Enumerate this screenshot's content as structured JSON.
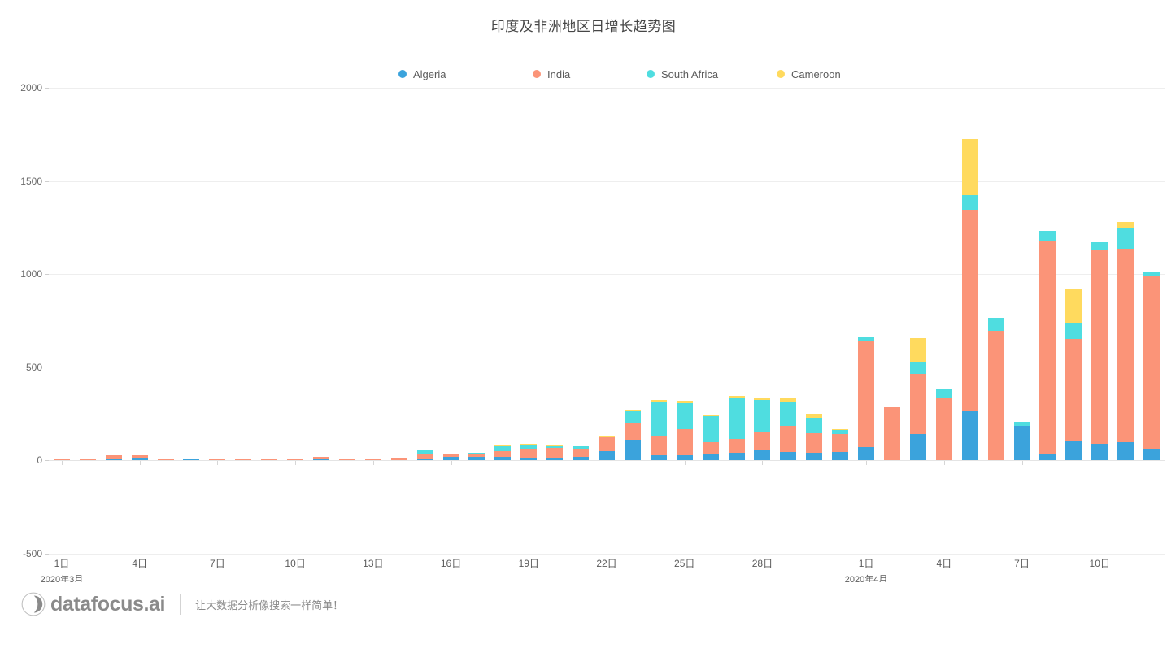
{
  "title": "印度及非洲地区日增长趋势图",
  "footer": {
    "logo_text": "datafocus.ai",
    "logo_icon": "datafocus-moon-icon",
    "tagline": "让大数据分析像搜索一样简单！"
  },
  "chart_data": {
    "type": "bar",
    "stacked": true,
    "title": "印度及非洲地区日增长趋势图",
    "xlabel": "",
    "ylabel": "",
    "ylim": [
      -500,
      2000
    ],
    "yticks": [
      2000,
      1500,
      1000,
      500,
      0,
      -500
    ],
    "ytick_labels": [
      "2000",
      "1500",
      "1000",
      "500",
      "0",
      "-500"
    ],
    "grid": true,
    "legend_position": "top-center",
    "colors": {
      "Algeria": "#3BA3DC",
      "India": "#FB9478",
      "South Africa": "#4FDDE0",
      "Cameroon": "#FFDA5E"
    },
    "legend": [
      "Algeria",
      "India",
      "South Africa",
      "Cameroon"
    ],
    "x_axis_ticks": [
      {
        "label": "1日",
        "sub": "2020年3月",
        "index": 0
      },
      {
        "label": "4日",
        "sub": "",
        "index": 3
      },
      {
        "label": "7日",
        "sub": "",
        "index": 6
      },
      {
        "label": "10日",
        "sub": "",
        "index": 9
      },
      {
        "label": "13日",
        "sub": "",
        "index": 12
      },
      {
        "label": "16日",
        "sub": "",
        "index": 15
      },
      {
        "label": "19日",
        "sub": "",
        "index": 18
      },
      {
        "label": "22日",
        "sub": "",
        "index": 21
      },
      {
        "label": "25日",
        "sub": "",
        "index": 24
      },
      {
        "label": "28日",
        "sub": "",
        "index": 27
      },
      {
        "label": "1日",
        "sub": "2020年4月",
        "index": 31
      },
      {
        "label": "4日",
        "sub": "",
        "index": 34
      },
      {
        "label": "7日",
        "sub": "",
        "index": 37
      },
      {
        "label": "10日",
        "sub": "",
        "index": 40
      }
    ],
    "categories": [
      "2020-03-01",
      "2020-03-02",
      "2020-03-03",
      "2020-03-04",
      "2020-03-05",
      "2020-03-06",
      "2020-03-07",
      "2020-03-08",
      "2020-03-09",
      "2020-03-10",
      "2020-03-11",
      "2020-03-12",
      "2020-03-13",
      "2020-03-14",
      "2020-03-15",
      "2020-03-16",
      "2020-03-17",
      "2020-03-18",
      "2020-03-19",
      "2020-03-20",
      "2020-03-21",
      "2020-03-22",
      "2020-03-23",
      "2020-03-24",
      "2020-03-25",
      "2020-03-26",
      "2020-03-27",
      "2020-03-28",
      "2020-03-29",
      "2020-03-30",
      "2020-03-31",
      "2020-04-01",
      "2020-04-02",
      "2020-04-03",
      "2020-04-04",
      "2020-04-05",
      "2020-04-06",
      "2020-04-07",
      "2020-04-08",
      "2020-04-09",
      "2020-04-10",
      "2020-04-11",
      "2020-04-12"
    ],
    "series": [
      {
        "name": "Algeria",
        "color": "#3BA3DC",
        "values": [
          0,
          0,
          5,
          12,
          0,
          3,
          0,
          2,
          2,
          0,
          3,
          0,
          0,
          2,
          8,
          17,
          18,
          17,
          15,
          15,
          19,
          49,
          110,
          25,
          30,
          34,
          40,
          58,
          42,
          40,
          45,
          72,
          0,
          139,
          0,
          265,
          0,
          185,
          36,
          104,
          88,
          94,
          62
        ]
      },
      {
        "name": "India",
        "color": "#FB9478",
        "values": [
          2,
          3,
          21,
          18,
          5,
          3,
          2,
          5,
          5,
          8,
          15,
          5,
          5,
          10,
          27,
          18,
          18,
          30,
          45,
          50,
          44,
          79,
          92,
          107,
          140,
          67,
          75,
          95,
          143,
          105,
          95,
          570,
          283,
          325,
          336,
          1080,
          693,
          0,
          1145,
          545,
          1045,
          1040,
          925
        ]
      },
      {
        "name": "South Africa",
        "color": "#4FDDE0",
        "values": [
          0,
          0,
          0,
          0,
          0,
          0,
          0,
          0,
          0,
          0,
          0,
          0,
          0,
          0,
          24,
          0,
          2,
          30,
          21,
          14,
          12,
          0,
          59,
          183,
          134,
          138,
          220,
          172,
          128,
          83,
          22,
          24,
          0,
          64,
          44,
          78,
          70,
          19,
          52,
          87,
          36,
          110,
          20
        ]
      },
      {
        "name": "Cameroon",
        "color": "#FFDA5E",
        "values": [
          0,
          0,
          0,
          0,
          0,
          0,
          0,
          0,
          0,
          0,
          0,
          0,
          0,
          0,
          0,
          0,
          0,
          3,
          3,
          3,
          0,
          5,
          11,
          8,
          14,
          3,
          10,
          9,
          18,
          20,
          3,
          0,
          0,
          127,
          0,
          300,
          0,
          0,
          0,
          183,
          0,
          37,
          0
        ]
      }
    ]
  }
}
